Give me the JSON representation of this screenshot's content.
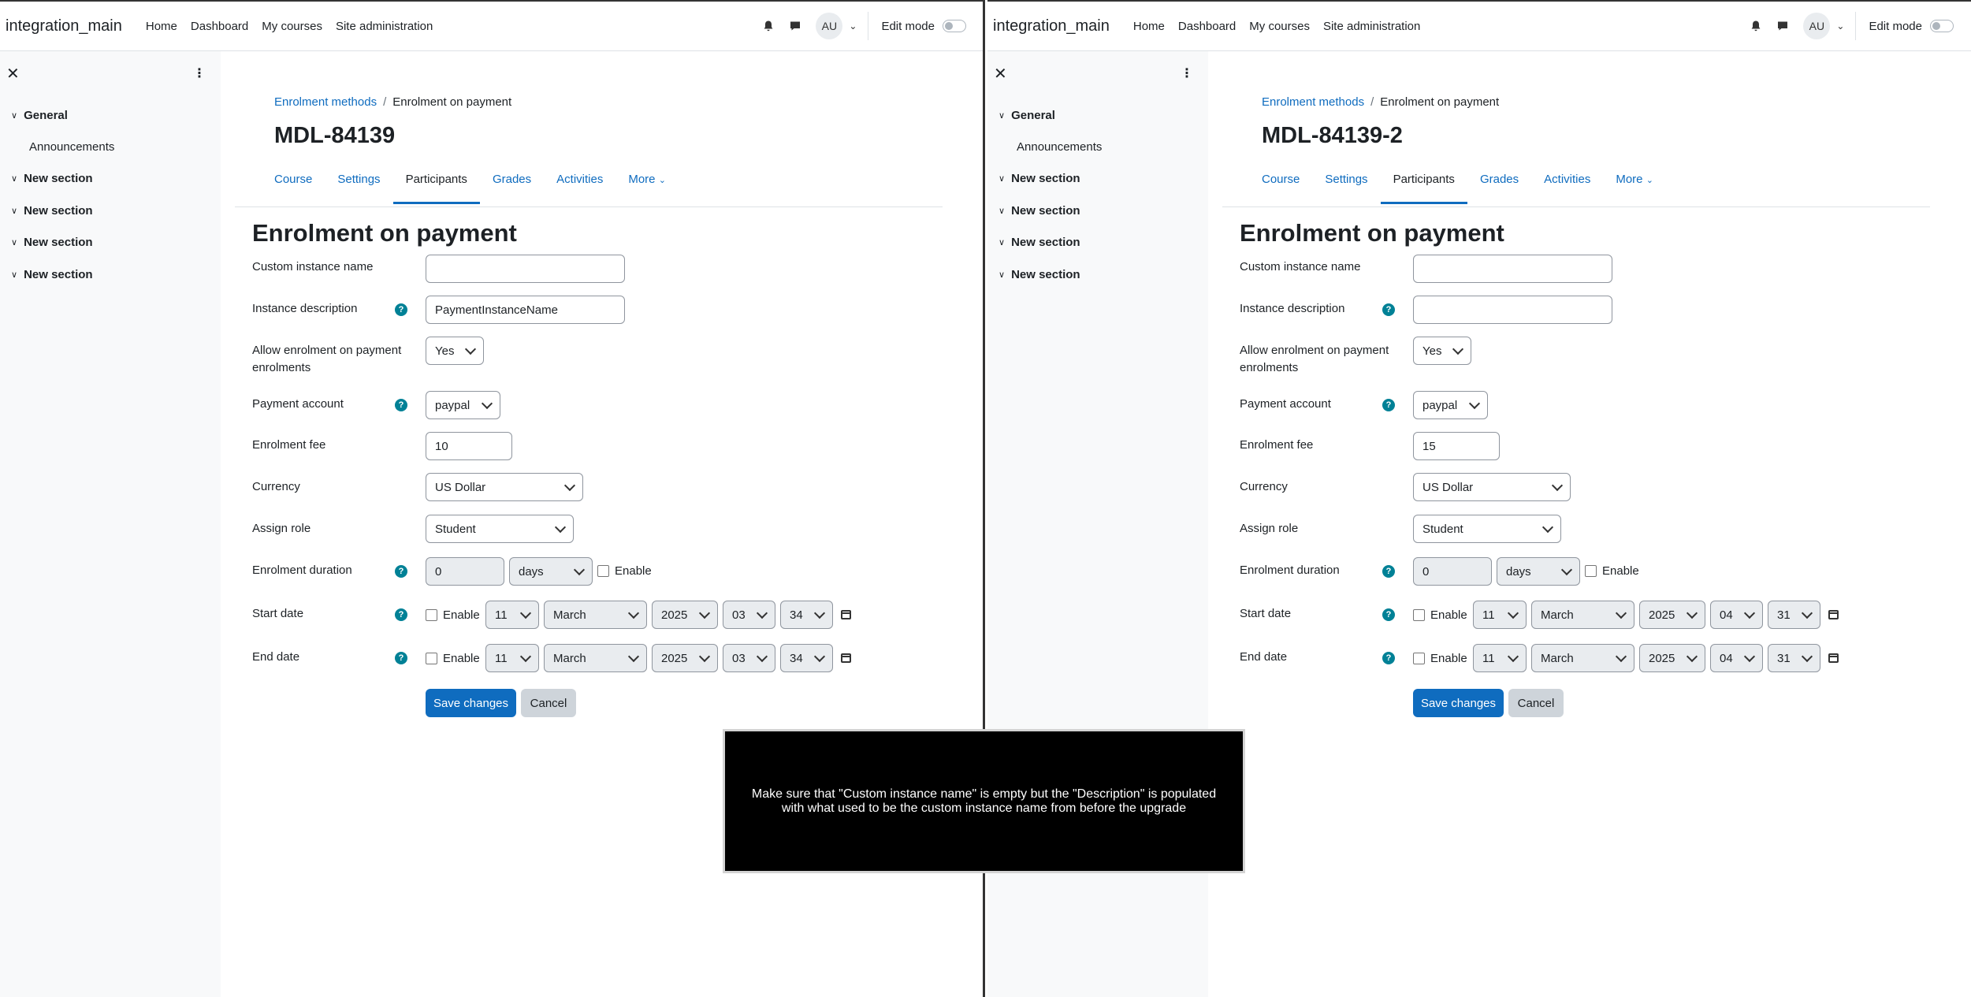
{
  "navbar": {
    "brand": "integration_main",
    "links": [
      "Home",
      "Dashboard",
      "My courses",
      "Site administration"
    ],
    "avatar": "AU",
    "edit_mode": "Edit mode"
  },
  "drawer": {
    "sections": [
      {
        "title": "General",
        "items": [
          "Announcements"
        ]
      },
      {
        "title": "New section",
        "items": []
      },
      {
        "title": "New section",
        "items": []
      },
      {
        "title": "New section",
        "items": []
      },
      {
        "title": "New section",
        "items": []
      }
    ]
  },
  "breadcrumb": {
    "parent": "Enrolment methods",
    "current": "Enrolment on payment"
  },
  "tabs": [
    "Course",
    "Settings",
    "Participants",
    "Grades",
    "Activities",
    "More"
  ],
  "form": {
    "heading": "Enrolment on payment",
    "labels": {
      "custom_name": "Custom instance name",
      "description": "Instance description",
      "allow": "Allow enrolment on payment enrolments",
      "account": "Payment account",
      "fee": "Enrolment fee",
      "currency": "Currency",
      "role": "Assign role",
      "duration": "Enrolment duration",
      "start": "Start date",
      "end": "End date",
      "enable": "Enable"
    },
    "save": "Save changes",
    "cancel": "Cancel",
    "help_glyph": "?"
  },
  "left": {
    "course_title": "MDL-84139",
    "custom_name": "",
    "description": "PaymentInstanceName",
    "allow": "Yes",
    "account": "paypal",
    "fee": "10",
    "currency": "US Dollar",
    "role": "Student",
    "duration_value": "0",
    "duration_unit": "days",
    "start": {
      "day": "11",
      "month": "March",
      "year": "2025",
      "hour": "03",
      "minute": "34"
    },
    "end": {
      "day": "11",
      "month": "March",
      "year": "2025",
      "hour": "03",
      "minute": "34"
    }
  },
  "right": {
    "course_title": "MDL-84139-2",
    "custom_name": "",
    "description": "",
    "allow": "Yes",
    "account": "paypal",
    "fee": "15",
    "currency": "US Dollar",
    "role": "Student",
    "duration_value": "0",
    "duration_unit": "days",
    "start": {
      "day": "11",
      "month": "March",
      "year": "2025",
      "hour": "04",
      "minute": "31"
    },
    "end": {
      "day": "11",
      "month": "March",
      "year": "2025",
      "hour": "04",
      "minute": "31"
    }
  },
  "overlay_text": "Make sure that \"Custom instance name\" is empty but the \"Description\" is populated with what used to be the custom instance name from before the upgrade",
  "colors": {
    "link": "#0f6cbf",
    "help": "#008196",
    "overlay_bg": "#000000"
  }
}
